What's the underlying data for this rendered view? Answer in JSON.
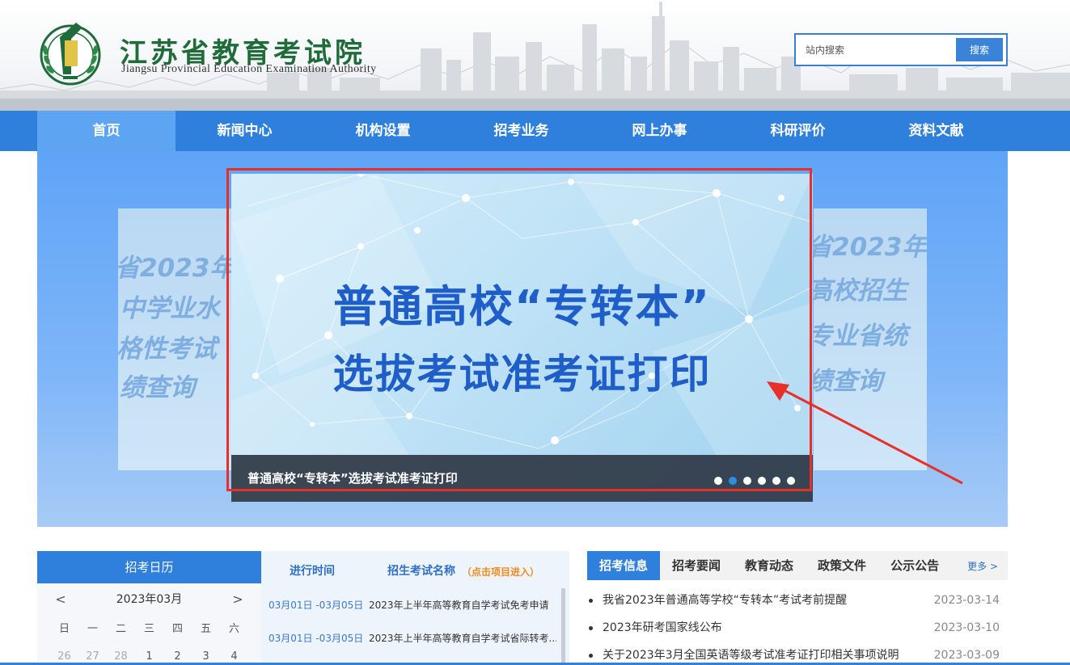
{
  "header": {
    "title_cn": "江苏省教育考试院",
    "title_en": "Jiangsu Provincial Education Examination Authority",
    "search_placeholder": "站内搜索",
    "search_button": "搜索"
  },
  "nav": {
    "items": [
      {
        "label": "首页"
      },
      {
        "label": "新闻中心"
      },
      {
        "label": "机构设置"
      },
      {
        "label": "招考业务"
      },
      {
        "label": "网上办事"
      },
      {
        "label": "科研评价"
      },
      {
        "label": "资料文献"
      }
    ],
    "active_index": 0
  },
  "banner": {
    "title_line1": "普通高校“专转本”",
    "title_line2": "选拔考试准考证打印",
    "caption": "普通高校“专转本”选拔考试准考证打印",
    "dot_count": 6,
    "active_dot": 1,
    "side_left": [
      "省2023年",
      "中学业水",
      "格性考试",
      "绩查询"
    ],
    "side_right": [
      "省2023年",
      "高校招生",
      "专业省统",
      "绩查询"
    ],
    "highlight_color": "#e8302b"
  },
  "calendar": {
    "title": "招考日历",
    "prev": "<",
    "next": ">",
    "month": "2023年03月",
    "weekdays": [
      "日",
      "一",
      "二",
      "三",
      "四",
      "五",
      "六"
    ],
    "days": [
      "26",
      "27",
      "28",
      "1",
      "2",
      "3",
      "4"
    ]
  },
  "schedule": {
    "col_time": "进行时间",
    "col_name": "招生考试名称",
    "col_hint": "（点击项目进入）",
    "rows": [
      {
        "date": "03月01日 -03月05日",
        "name": "2023年上半年高等教育自学考试免考申请"
      },
      {
        "date": "03月01日 -03月05日",
        "name": "2023年上半年高等教育自学考试省际转考..."
      }
    ]
  },
  "news": {
    "tabs": [
      "招考信息",
      "招考要闻",
      "教育动态",
      "政策文件",
      "公示公告"
    ],
    "more": "更多 >",
    "items": [
      {
        "title": "我省2023年普通高等学校“专转本”考试考前提醒",
        "date": "2023-03-14"
      },
      {
        "title": "2023年研考国家线公布",
        "date": "2023-03-10"
      },
      {
        "title": "关于2023年3月全国英语等级考试准考证打印相关事项说明",
        "date": "2023-03-09"
      }
    ]
  },
  "colors": {
    "brand_green": "#1f6b3a",
    "nav_blue": "#2f7fdc",
    "nav_active": "#5da4f2",
    "accent_orange": "#f08a1c"
  }
}
